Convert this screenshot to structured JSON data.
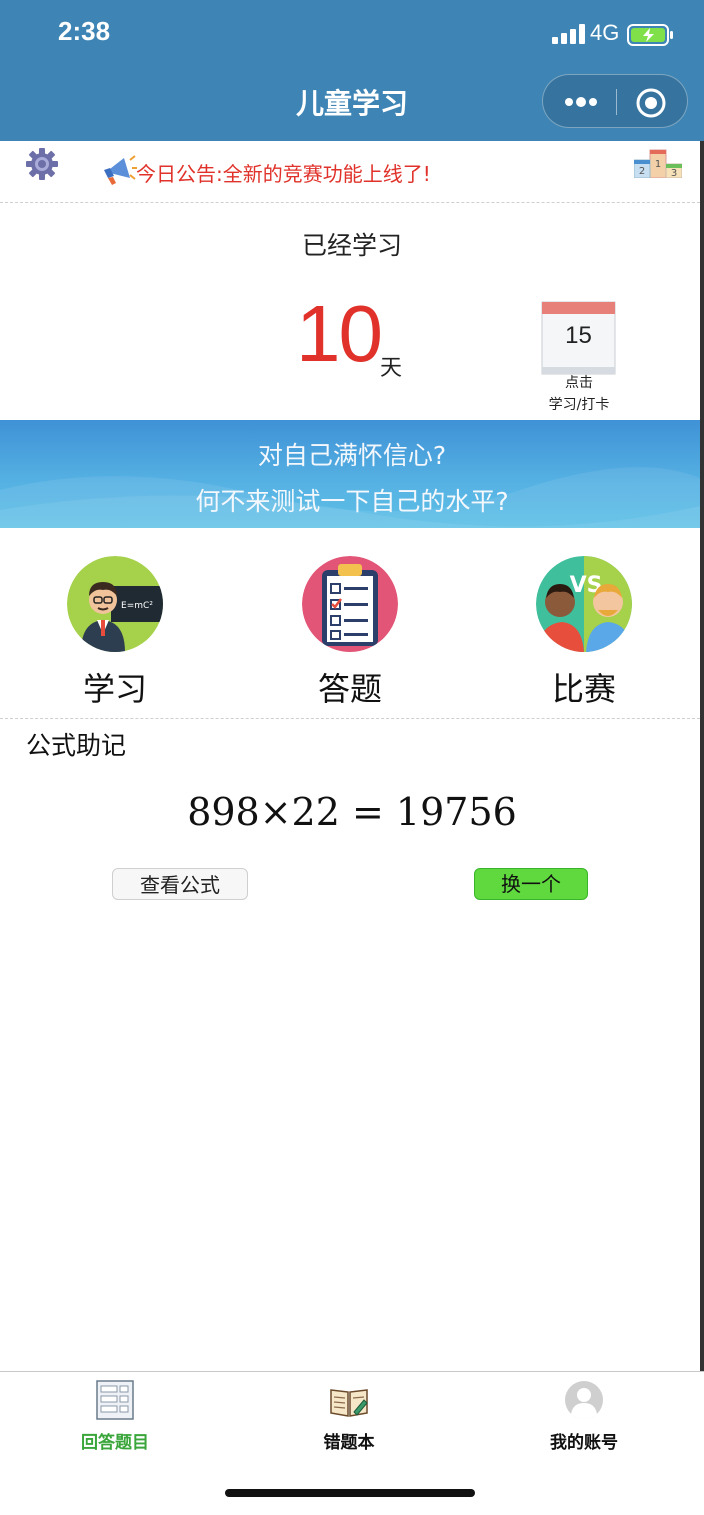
{
  "status_bar": {
    "time": "2:38",
    "network": "4G"
  },
  "nav": {
    "title": "儿童学习"
  },
  "notice": {
    "text": "今日公告:全新的竞赛功能上线了!"
  },
  "studied": {
    "label": "已经学习",
    "days": "10",
    "unit": "天"
  },
  "checkin": {
    "date": "15",
    "hint_line1": "点击",
    "hint_line2": "学习/打卡"
  },
  "banner": {
    "line1": "对自己满怀信心?",
    "line2": "何不来测试一下自己的水平?"
  },
  "features": [
    {
      "label": "学习"
    },
    {
      "label": "答题"
    },
    {
      "label": "比赛"
    }
  ],
  "formula": {
    "title": "公式助记",
    "expression": "898×22 = 19756",
    "view_button": "查看公式",
    "next_button": "换一个"
  },
  "tabbar": {
    "items": [
      {
        "label": "回答题目",
        "active": true
      },
      {
        "label": "错题本",
        "active": false
      },
      {
        "label": "我的账号",
        "active": false
      }
    ],
    "active_color": "#3aa53a"
  },
  "colors": {
    "nav_bg": "#3e85b5",
    "accent_red": "#e0322a",
    "next_green": "#5fd93e"
  }
}
